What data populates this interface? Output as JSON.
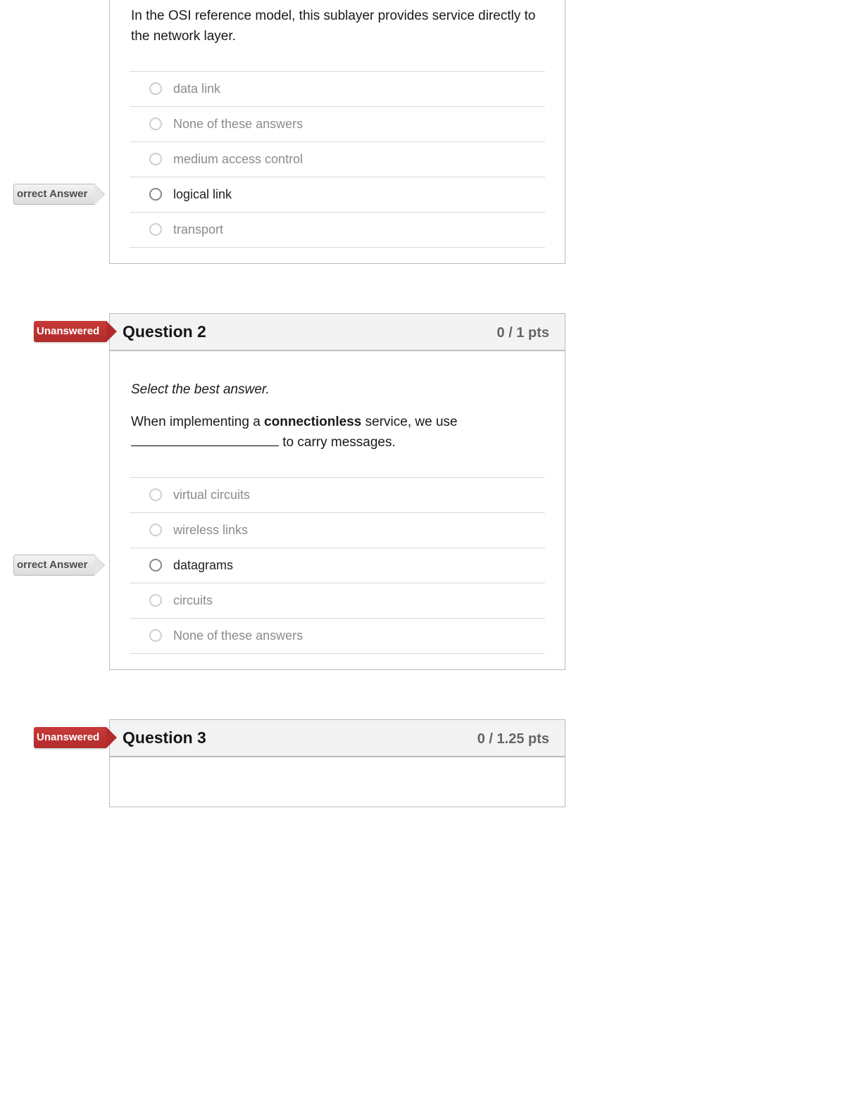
{
  "labels": {
    "unanswered": "Unanswered",
    "correct_answer": "orrect Answer"
  },
  "questions": [
    {
      "id": "q1",
      "header_visible": false,
      "title": "",
      "points": "",
      "prompt_plain": "In the OSI reference model, this sublayer provides service directly to the network layer.",
      "answers": [
        {
          "text": "data link",
          "correct": false
        },
        {
          "text": "None of these answers",
          "correct": false
        },
        {
          "text": "medium access control",
          "correct": false
        },
        {
          "text": "logical link",
          "correct": true
        },
        {
          "text": "transport",
          "correct": false
        }
      ]
    },
    {
      "id": "q2",
      "header_visible": true,
      "title": "Question 2",
      "points": "0 / 1 pts",
      "flag": "unanswered",
      "instruction": "Select the best answer.",
      "prompt_pre": "When implementing a ",
      "prompt_bold": "connectionless",
      "prompt_mid": " service, we use ",
      "prompt_post": " to carry messages.",
      "answers": [
        {
          "text": "virtual circuits",
          "correct": false
        },
        {
          "text": "wireless links",
          "correct": false
        },
        {
          "text": "datagrams",
          "correct": true
        },
        {
          "text": "circuits",
          "correct": false
        },
        {
          "text": "None of these answers",
          "correct": false
        }
      ]
    },
    {
      "id": "q3",
      "header_visible": true,
      "title": "Question 3",
      "points": "0 / 1.25 pts",
      "flag": "unanswered",
      "body_visible": false
    }
  ]
}
